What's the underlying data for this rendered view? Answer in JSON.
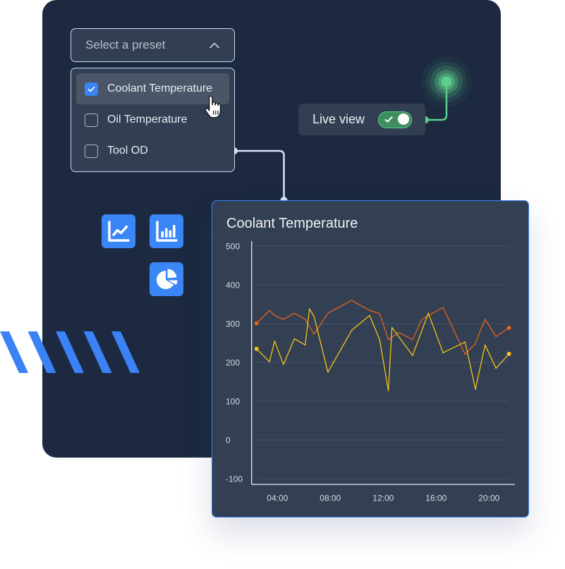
{
  "preset_select": {
    "placeholder": "Select a preset",
    "expanded": true
  },
  "preset_options": [
    {
      "label": "Coolant Temperature",
      "checked": true,
      "hovered": true
    },
    {
      "label": "Oil Temperature",
      "checked": false,
      "hovered": false
    },
    {
      "label": "Tool OD",
      "checked": false,
      "hovered": false
    }
  ],
  "live_view": {
    "label": "Live view",
    "enabled": true,
    "status_icon": "live-beacon-icon"
  },
  "chart_type_buttons": [
    {
      "icon": "line-chart-icon"
    },
    {
      "icon": "bar-chart-icon"
    },
    {
      "icon": "pie-chart-icon"
    }
  ],
  "colors": {
    "accent": "#3b82f6",
    "panel": "#1c2940",
    "card": "#323e52",
    "live": "#5ccf8c",
    "toggle_on": "#3e8e5d"
  },
  "chart_data": {
    "type": "line",
    "title": "Coolant Temperature",
    "xlabel": "",
    "ylabel": "",
    "x_unit": "hours",
    "xlim": [
      2,
      22
    ],
    "ylim": [
      -100,
      500
    ],
    "grid": true,
    "legend": "none",
    "y_ticks": [
      500,
      400,
      300,
      200,
      100,
      0,
      -100
    ],
    "x_ticks": [
      {
        "value": 4,
        "label": "04:00"
      },
      {
        "value": 8,
        "label": "08:00"
      },
      {
        "value": 12,
        "label": "12:00"
      },
      {
        "value": 16,
        "label": "16:00"
      },
      {
        "value": 20,
        "label": "20:00"
      }
    ],
    "series": [
      {
        "color": "#e5641c",
        "x": [
          2.42,
          3.4,
          3.79,
          4.46,
          5.28,
          6.1,
          6.77,
          7.82,
          9.62,
          10.97,
          11.73,
          12.39,
          13.19,
          14.22,
          14.93,
          16.53,
          18.19,
          18.93,
          19.7,
          20.53,
          21.51
        ],
        "values": [
          301,
          334,
          321,
          311,
          327,
          311,
          273,
          327,
          360,
          334,
          326,
          259,
          277,
          259,
          311,
          342,
          221,
          247,
          311,
          267,
          289
        ]
      },
      {
        "color": "#f5c21a",
        "x": [
          2.42,
          3.4,
          3.79,
          4.46,
          5.28,
          6.1,
          6.42,
          6.77,
          7.82,
          9.62,
          10.97,
          11.73,
          12.39,
          12.66,
          14.22,
          15.41,
          16.53,
          18.19,
          18.97,
          19.7,
          20.53,
          21.51
        ],
        "values": [
          235,
          202,
          255,
          195,
          261,
          245,
          338,
          319,
          175,
          283,
          321,
          259,
          127,
          290,
          218,
          327,
          225,
          253,
          131,
          245,
          185,
          222
        ]
      }
    ]
  }
}
